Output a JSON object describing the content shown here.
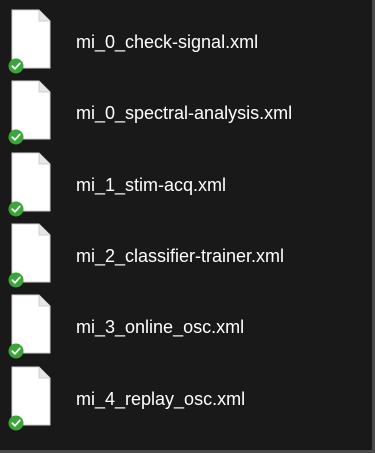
{
  "files": [
    {
      "name": "mi_0_check-signal.xml",
      "icon": "xml-document-icon",
      "status_icon": "synced-checkmark-icon"
    },
    {
      "name": "mi_0_spectral-analysis.xml",
      "icon": "xml-document-icon",
      "status_icon": "synced-checkmark-icon"
    },
    {
      "name": "mi_1_stim-acq.xml",
      "icon": "xml-document-icon",
      "status_icon": "synced-checkmark-icon"
    },
    {
      "name": "mi_2_classifier-trainer.xml",
      "icon": "xml-document-icon",
      "status_icon": "synced-checkmark-icon"
    },
    {
      "name": "mi_3_online_osc.xml",
      "icon": "xml-document-icon",
      "status_icon": "synced-checkmark-icon"
    },
    {
      "name": "mi_4_replay_osc.xml",
      "icon": "xml-document-icon",
      "status_icon": "synced-checkmark-icon"
    }
  ],
  "colors": {
    "background": "#191919",
    "text": "#ffffff",
    "document": "#ffffff",
    "sync_badge": "#3aa63a"
  }
}
